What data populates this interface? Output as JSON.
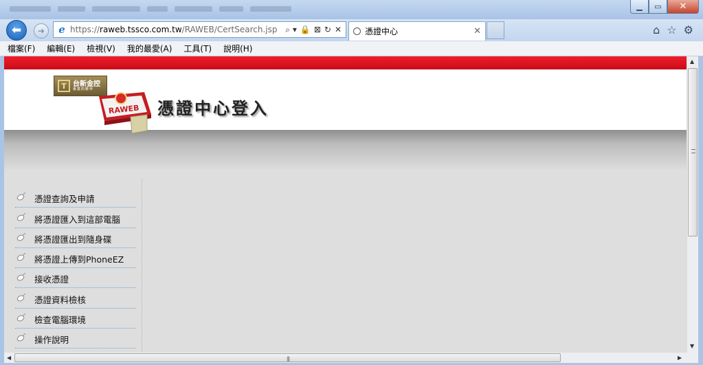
{
  "window": {
    "minimize_icon": "minimize-icon",
    "maximize_icon": "maximize-icon",
    "close_glyph": "✕"
  },
  "navigation": {
    "back_glyph": "⬅",
    "forward_glyph": "➜",
    "url_scheme": "https://",
    "url_host": "raweb.tssco.com.tw",
    "url_path": "/RAWEB/CertSearch.jsp",
    "address_icons": [
      "⌕ ▾",
      "🔒",
      "⊠",
      "↻",
      "✕"
    ]
  },
  "tab": {
    "title": "憑證中心",
    "close_glyph": "✕"
  },
  "toolbar_icons": [
    "⌂",
    "☆",
    "⚙"
  ],
  "menu": [
    "檔案(F)",
    "編輯(E)",
    "檢視(V)",
    "我的最愛(A)",
    "工具(T)",
    "說明(H)"
  ],
  "page": {
    "logo_text": "台新金控",
    "logo_subtext": "專業的夥伴",
    "emblem_text": "RAWEB",
    "heading": "憑證中心登入",
    "nav_items": [
      "憑證查詢及申請",
      "將憑證匯入到這部電腦",
      "將憑證匯出到隨身碟",
      "將憑證上傳到PhoneEZ",
      "接收憑證",
      "憑證資料檢核",
      "檢查電腦環境",
      "操作說明"
    ]
  },
  "colors": {
    "red_bar": "#e3131f",
    "nav_divider": "#6fa2d0",
    "content_bg": "#dedede"
  }
}
